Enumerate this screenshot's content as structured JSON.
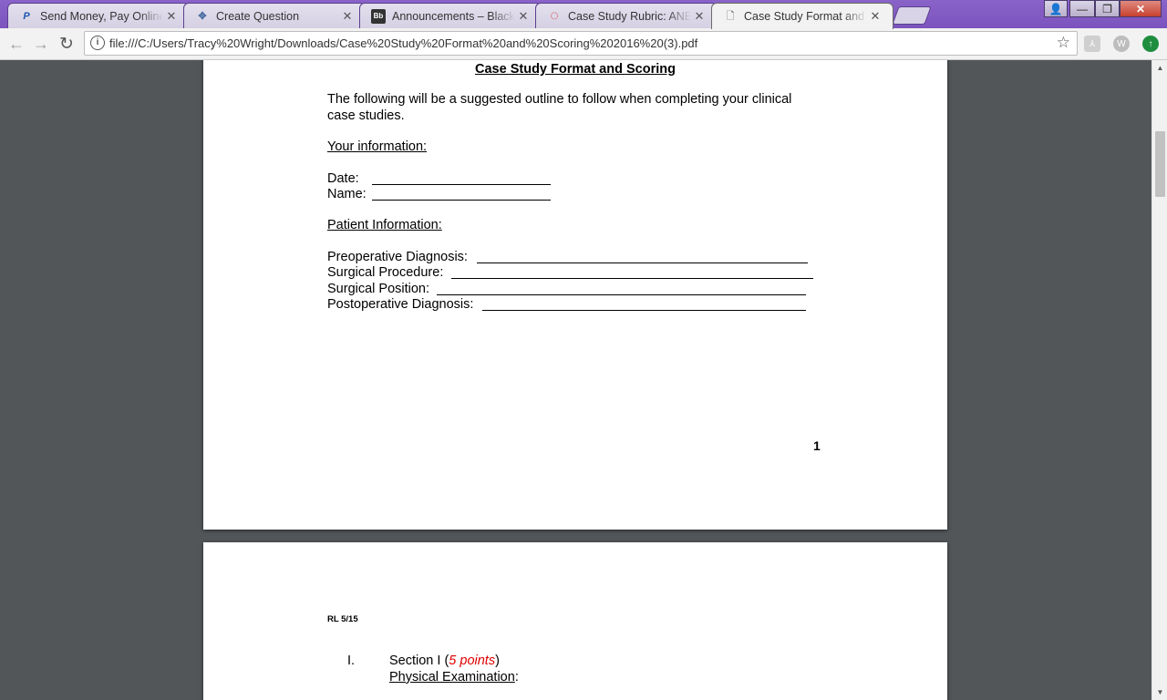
{
  "tabs": [
    {
      "title": "Send Money, Pay Online",
      "favicon": "P",
      "close": "✕"
    },
    {
      "title": "Create Question",
      "favicon": "✥",
      "close": "✕"
    },
    {
      "title": "Announcements – Blackboard",
      "favicon": "Bb",
      "close": "✕"
    },
    {
      "title": "Case Study Rubric: ANE-",
      "favicon": "◌",
      "close": "✕"
    },
    {
      "title": "Case Study Format and Scoring",
      "favicon": "🗋",
      "close": "✕"
    }
  ],
  "window_controls": {
    "user": "👤",
    "minimize": "—",
    "maximize": "❐",
    "close": "✕"
  },
  "toolbar": {
    "back": "←",
    "forward": "→",
    "reload": "↻",
    "url": "file:///C:/Users/Tracy%20Wright/Downloads/Case%20Study%20Format%20and%20Scoring%202016%20(3).pdf",
    "info": "i",
    "star": "☆"
  },
  "extensions": [
    {
      "name": "pdf-extension-icon",
      "glyph": "⅄"
    },
    {
      "name": "w-extension-icon",
      "glyph": "W"
    },
    {
      "name": "green-arrow-extension-icon",
      "glyph": "↑"
    }
  ],
  "document": {
    "title": "Case Study Format and Scoring",
    "intro_line1": "The following will be a suggested outline to follow when completing your clinical",
    "intro_line2": "case studies.",
    "your_info_heading": "Your information:",
    "date_label": "Date:",
    "name_label": "Name:",
    "patient_info_heading": "Patient Information:",
    "preop_label": "Preoperative Diagnosis:",
    "procedure_label": "Surgical Procedure:",
    "position_label": "Surgical Position:",
    "postop_label": "Postoperative Diagnosis:",
    "page_number": "1",
    "page2_header": "RL 5/15",
    "section1_number": "I.",
    "section1_label": "Section I (",
    "section1_points": "5 points",
    "section1_close": ")",
    "section1_subheading": "Physical Examination",
    "section1_colon": ":"
  },
  "scrollbar": {
    "up": "▲",
    "down": "▼"
  }
}
